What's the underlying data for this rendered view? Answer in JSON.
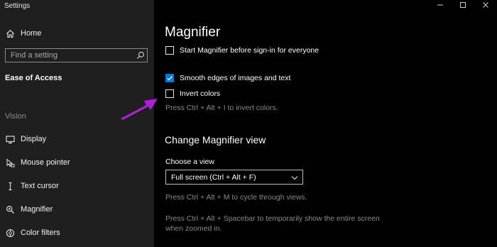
{
  "window": {
    "title": "Settings"
  },
  "sidebar": {
    "home_label": "Home",
    "search_placeholder": "Find a setting",
    "section_heading": "Ease of Access",
    "group_label": "Vision",
    "items": [
      {
        "label": "Display",
        "icon": "display-icon"
      },
      {
        "label": "Mouse pointer",
        "icon": "mouse-pointer-icon"
      },
      {
        "label": "Text cursor",
        "icon": "text-cursor-icon"
      },
      {
        "label": "Magnifier",
        "icon": "magnifier-icon"
      },
      {
        "label": "Color filters",
        "icon": "color-filters-icon"
      }
    ]
  },
  "main": {
    "title": "Magnifier",
    "options": [
      {
        "label": "Start Magnifier before sign-in for everyone",
        "checked": false
      },
      {
        "label": "Smooth edges of images and text",
        "checked": true
      },
      {
        "label": "Invert colors",
        "checked": false
      }
    ],
    "invert_hint": "Press Ctrl + Alt + I to invert colors.",
    "view_heading": "Change Magnifier view",
    "view_label": "Choose a view",
    "view_selected": "Full screen (Ctrl + Alt + F)",
    "cycle_hint": "Press Ctrl + Alt + M to cycle through views.",
    "spacebar_hint": "Press Ctrl + Alt + Spacebar to temporarily show the entire screen when zoomed in."
  },
  "colors": {
    "accent": "#0078d7",
    "annotation": "#b01fd8",
    "sidebar_bg": "#1f1f1f",
    "content_bg": "#000000"
  }
}
